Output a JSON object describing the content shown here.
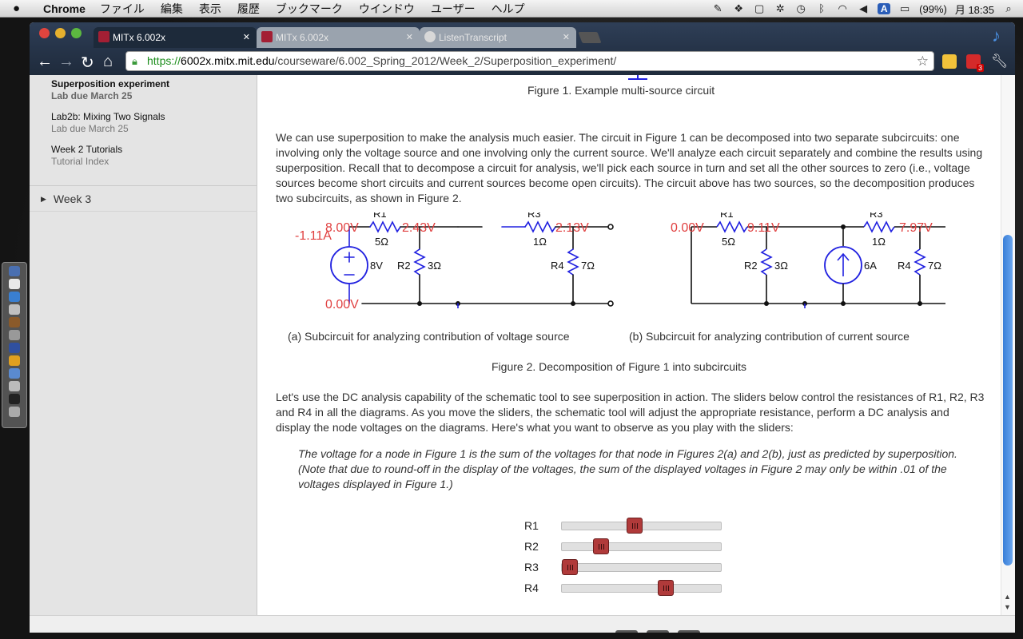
{
  "menubar": {
    "app_name": "Chrome",
    "menus": [
      "ファイル",
      "編集",
      "表示",
      "履歴",
      "ブックマーク",
      "ウインドウ",
      "ユーザー",
      "ヘルプ"
    ],
    "battery": "(99%)",
    "clock": "月 18:35"
  },
  "tabs": [
    {
      "title": "MITx 6.002x",
      "active": true
    },
    {
      "title": "MITx 6.002x",
      "active": false
    },
    {
      "title": "ListenTranscript",
      "active": false
    }
  ],
  "address": {
    "scheme": "https://",
    "domain": "6002x.mitx.mit.edu",
    "path": "/courseware/6.002_Spring_2012/Week_2/Superposition_experiment/"
  },
  "mail_badge": "3",
  "sidebar": {
    "items": [
      {
        "title": "Superposition experiment",
        "subtitle": "Lab due March 25",
        "active": true
      },
      {
        "title": "Lab2b: Mixing Two Signals",
        "subtitle": "Lab due March 25",
        "active": false
      },
      {
        "title": "Week 2 Tutorials",
        "subtitle": "Tutorial Index",
        "active": false
      }
    ],
    "week3": "Week 3"
  },
  "content": {
    "fig1_caption": "Figure 1. Example multi-source circuit",
    "para1": "We can use superposition to make the analysis much easier. The circuit in Figure 1 can be decomposed into two separate subcircuits: one involving only the voltage source and one involving only the current source. We'll analyze each circuit separately and combine the results using superposition. Recall that to decompose a circuit for analysis, we'll pick each source in turn and set all the other sources to zero (i.e., voltage sources become short circuits and current sources become open circuits). The circuit above has two sources, so the decomposition produces two subcircuits, as shown in Figure 2.",
    "sub_a_caption": "(a) Subcircuit for analyzing contribution of voltage source",
    "sub_b_caption": "(b) Subcircuit for analyzing contribution of current source",
    "fig2_caption": "Figure 2. Decomposition of Figure 1 into subcircuits",
    "para2": "Let's use the DC analysis capability of the schematic tool to see superposition in action. The sliders below control the resistances of R1, R2, R3 and R4 in all the diagrams. As you move the sliders, the schematic tool will adjust the appropriate resistance, perform a DC analysis and display the node voltages on the diagrams. Here's what you want to observe as you play with the sliders:",
    "emphasis": "The voltage for a node in Figure 1 is the sum of the voltages for that node in Figures 2(a) and 2(b), just as predicted by superposition. (Note that due to round-off in the display of the voltages, the sum of the displayed voltages in Figure 2 may only be within .01 of the voltages displayed in Figure 1.)"
  },
  "circuit_a": {
    "r1_label": "R1",
    "r1_value": "5Ω",
    "r2_label": "R2",
    "r2_value": "3Ω",
    "r3_label": "R3",
    "r3_value": "1Ω",
    "r4_label": "R4",
    "r4_value": "7Ω",
    "source_value": "8V",
    "current_readout": "-1.11A",
    "v_node1": "8.00V",
    "v_node2": "2.43V",
    "v_node3": "2.13V",
    "v_ground": "0.00V"
  },
  "circuit_b": {
    "r1_label": "R1",
    "r1_value": "5Ω",
    "r2_label": "R2",
    "r2_value": "3Ω",
    "r3_label": "R3",
    "r3_value": "1Ω",
    "r4_label": "R4",
    "r4_value": "7Ω",
    "source_value": "6A",
    "v_node1": "0.00V",
    "v_node2": "9.11V",
    "v_node3": "7.97V"
  },
  "sliders": [
    {
      "label": "R1",
      "position": 0.45
    },
    {
      "label": "R2",
      "position": 0.22
    },
    {
      "label": "R3",
      "position": 0.0
    },
    {
      "label": "R4",
      "position": 0.67
    }
  ],
  "colors": {
    "wire": "#2020e0",
    "node": "#111111",
    "voltage_label": "#e04040",
    "slider_thumb": "#b03a3a"
  }
}
